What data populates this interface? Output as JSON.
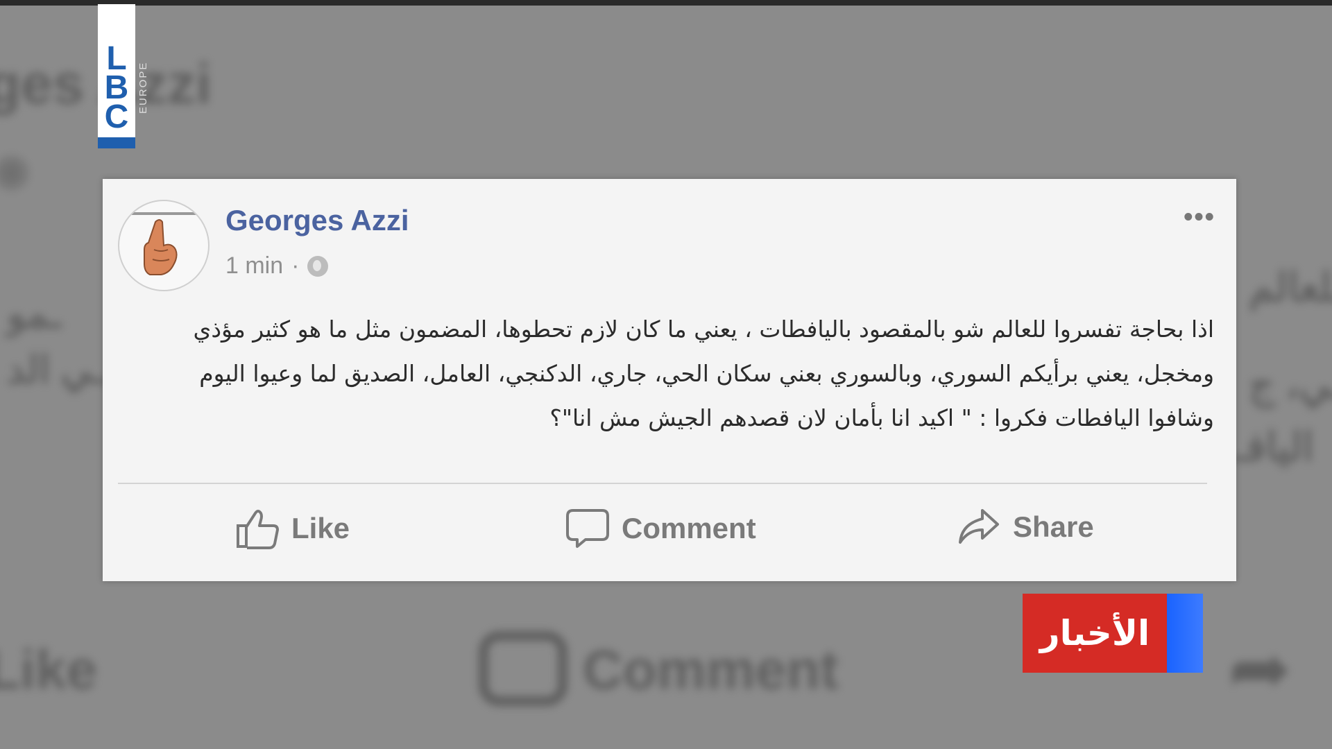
{
  "broadcast": {
    "logo_letters": [
      "L",
      "B",
      "C"
    ],
    "logo_sub": "EUROPE",
    "brand_color": "#1f5fae",
    "news_label": "الأخبار",
    "news_colors": {
      "red": "#d52b25",
      "blue": "#1a63ff"
    }
  },
  "background_blur": {
    "author": "ges Azzi",
    "like": "Like",
    "comment": "Comment"
  },
  "post": {
    "author": "Georges Azzi",
    "time": "1 min",
    "separator": "·",
    "privacy_icon": "globe-icon",
    "more_icon": "more-options-icon",
    "text": "اذا بحاجة تفسروا للعالم شو بالمقصود باليافطات ، يعني ما كان لازم تحطوها، المضمون مثل ما هو كثير مؤذي ومخجل، يعني برأيكم السوري، وبالسوري بعني سكان الحي، جاري، الدكنجي، العامل، الصديق لما وعيوا اليوم وشافوا اليافطات فكروا : \" اكيد انا بأمان لان قصدهم الجيش مش انا\"؟",
    "author_color": "#4b63a0"
  },
  "actions": {
    "like": "Like",
    "comment": "Comment",
    "share": "Share"
  }
}
